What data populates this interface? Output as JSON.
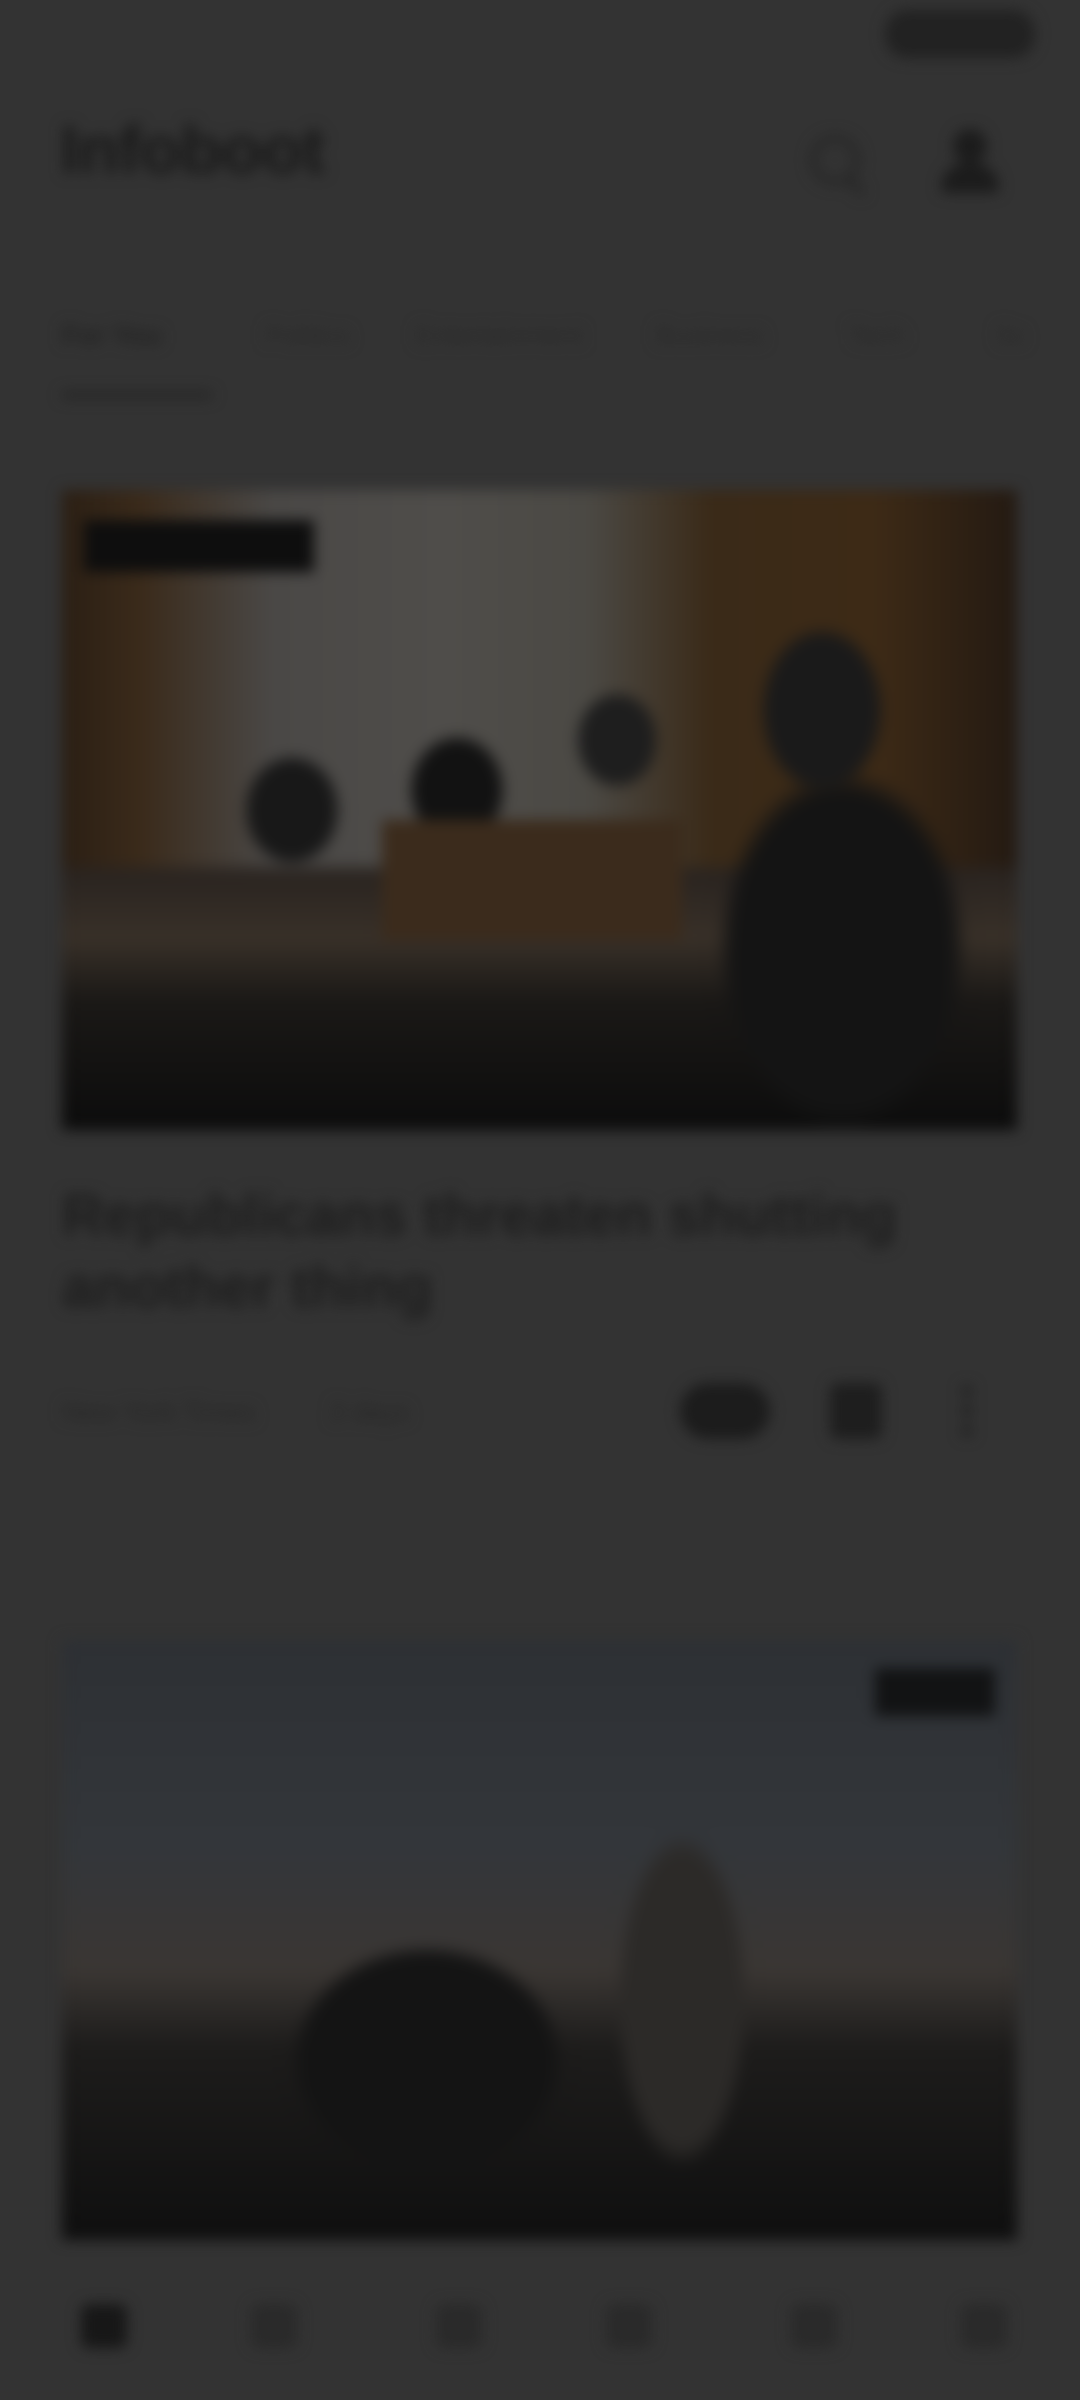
{
  "app": {
    "logo_text": "Infoboot"
  },
  "header": {
    "icons": [
      "search-icon",
      "account-icon"
    ]
  },
  "tabs": [
    {
      "label": "For You",
      "active": true
    },
    {
      "label": "Politics"
    },
    {
      "label": "Entertainment"
    },
    {
      "label": "Business"
    },
    {
      "label": "Tech"
    },
    {
      "label": "Sc"
    }
  ],
  "articles": [
    {
      "headline": "Republicans threaten shutting another thing",
      "source": "New York Times",
      "time": "2 days"
    },
    {
      "headline": "",
      "source": "",
      "time": ""
    }
  ],
  "bottom_nav": {
    "items": [
      {
        "icon": "home-icon",
        "active": true
      },
      {
        "icon": "explore-icon"
      },
      {
        "icon": "video-icon"
      },
      {
        "icon": "live-icon"
      },
      {
        "icon": "bookmarks-icon"
      },
      {
        "icon": "menu-icon"
      }
    ]
  },
  "colors": {
    "background": "#333333",
    "text": "#1e1e1e"
  }
}
